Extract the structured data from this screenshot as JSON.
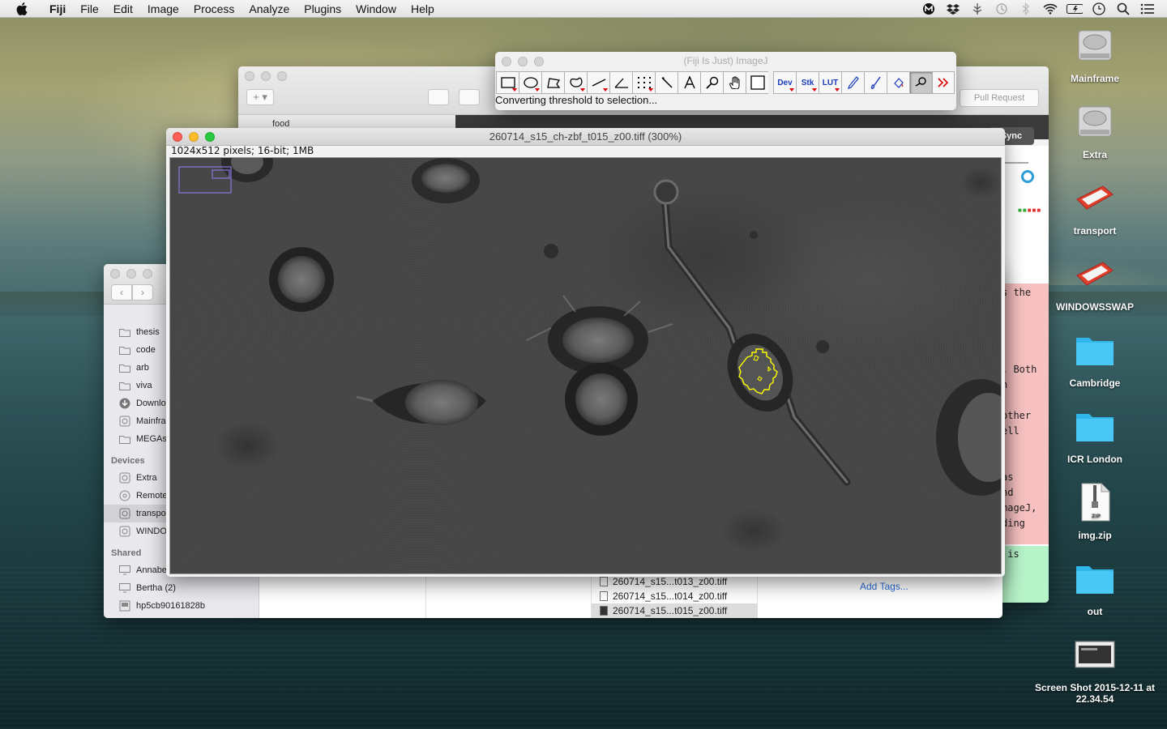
{
  "menubar": {
    "app_name": "Fiji",
    "items": [
      "File",
      "Edit",
      "Image",
      "Process",
      "Analyze",
      "Plugins",
      "Window",
      "Help"
    ],
    "status_icons": [
      "malwarebytes-icon",
      "dropbox-icon",
      "tree-icon",
      "time-machine-icon",
      "bluetooth-icon",
      "wifi-icon",
      "battery-icon",
      "clock-icon",
      "spotlight-icon",
      "notification-center-icon"
    ]
  },
  "github_window": {
    "repo_item": "food",
    "sync_label": "Sync",
    "pull_request_label": "Pull Request",
    "code_lines": [
      "s the",
      ". Both",
      "h",
      "other",
      "ell",
      "as",
      "nd",
      "mageJ,",
      "ding",
      " is"
    ]
  },
  "imagej_toolbar": {
    "title": "(Fiji Is Just) ImageJ",
    "tools": [
      "rectangle",
      "oval",
      "polygon",
      "freehand",
      "line",
      "angle",
      "point",
      "wand",
      "text",
      "magnifier",
      "hand",
      "color-picker",
      "Dev",
      "Stk",
      "LUT",
      "pencil",
      "brush",
      "flood-fill",
      "roi-manager",
      "more"
    ],
    "status": "Converting threshold to selection..."
  },
  "image_window": {
    "title": "260714_s15_ch-zbf_t015_z00.tiff (300%)",
    "info": "1024x512 pixels; 16-bit; 1MB"
  },
  "finder": {
    "favorites": [
      "thesis",
      "code",
      "arb",
      "viva",
      "Downloads",
      "Mainframe",
      "MEGAsync"
    ],
    "devices_header": "Devices",
    "devices": [
      "Extra",
      "Remote Disc",
      "transport",
      "WINDOWSSWAP"
    ],
    "shared_header": "Shared",
    "shared": [
      "Annabel",
      "Bertha (2)",
      "hp5cb90161828b"
    ],
    "files": [
      "260714_s15...t013_z00.tiff",
      "260714_s15...t014_z00.tiff",
      "260714_s15...t015_z00.tiff"
    ],
    "add_tags": "Add Tags..."
  },
  "desktop_icons": [
    {
      "label": "Mainframe",
      "icon": "hard-drive-icon"
    },
    {
      "label": "Extra",
      "icon": "hard-drive-icon"
    },
    {
      "label": "transport",
      "icon": "external-drive-icon"
    },
    {
      "label": "WINDOWSSWAP",
      "icon": "external-drive-icon"
    },
    {
      "label": "Cambridge",
      "icon": "folder-icon"
    },
    {
      "label": "ICR London",
      "icon": "folder-icon"
    },
    {
      "label": "img.zip",
      "icon": "zip-icon"
    },
    {
      "label": "out",
      "icon": "folder-icon"
    },
    {
      "label": "Screen Shot 2015-12-11 at 22.34.54",
      "icon": "screenshot-icon"
    }
  ],
  "colors": {
    "selection_outline": "#ffff00",
    "folder_blue": "#3ec4f2",
    "drive_red": "#e0402a"
  }
}
